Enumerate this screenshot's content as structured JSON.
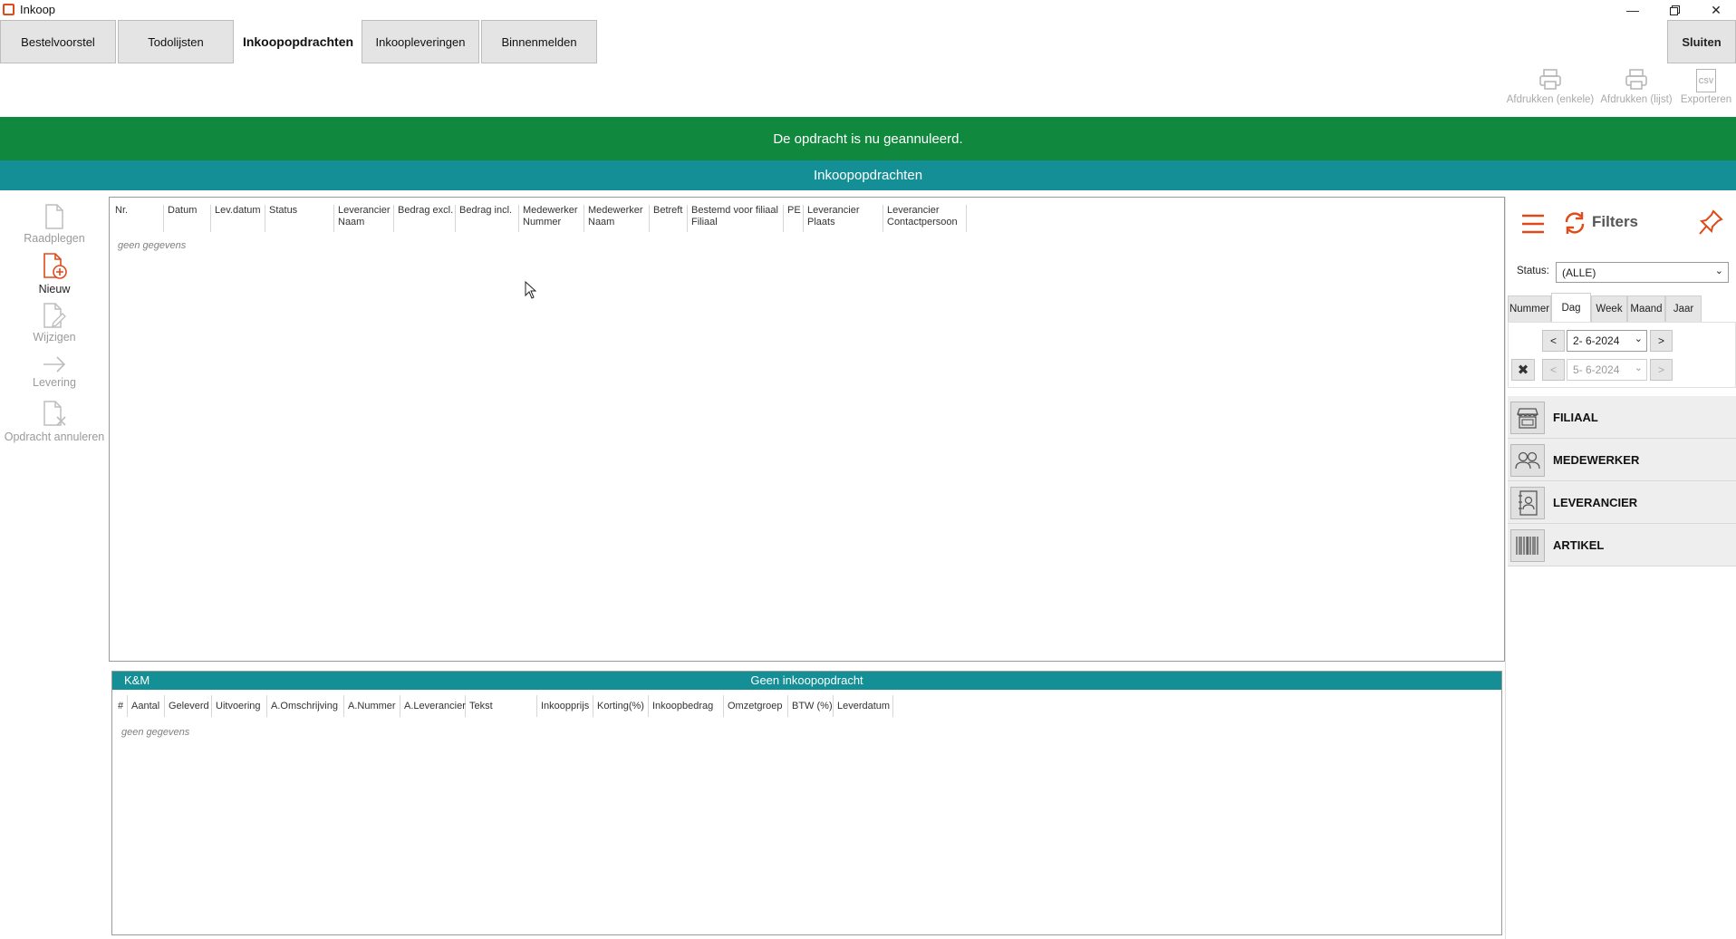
{
  "window": {
    "title": "Inkoop",
    "controls": [
      "minimize-icon",
      "restore-icon",
      "close-icon"
    ]
  },
  "tabs": [
    {
      "label": "Bestelvoorstel",
      "active": false
    },
    {
      "label": "Todolijsten",
      "active": false
    },
    {
      "label": "Inkoopopdrachten",
      "active": true
    },
    {
      "label": "Inkoopleveringen",
      "active": false
    },
    {
      "label": "Binnenmelden",
      "active": false
    }
  ],
  "close_button": "Sluiten",
  "toolbar": {
    "print_single": "Afdrukken (enkele)",
    "print_list": "Afdrukken (lijst)",
    "export": "Exporteren",
    "export_icon_text": "CSV"
  },
  "banners": {
    "success": "De opdracht is nu geannuleerd.",
    "section": "Inkoopopdrachten"
  },
  "sidebar": {
    "actions": [
      {
        "label": "Raadplegen",
        "icon": "document-icon",
        "enabled": false
      },
      {
        "label": "Nieuw",
        "icon": "new-document-icon",
        "enabled": true
      },
      {
        "label": "Wijzigen",
        "icon": "edit-document-icon",
        "enabled": false
      },
      {
        "label": "Levering",
        "icon": "arrow-right-icon",
        "enabled": false
      },
      {
        "label": "Opdracht annuleren",
        "icon": "cancel-document-icon",
        "enabled": false
      }
    ]
  },
  "main_grid": {
    "columns": [
      [
        "Nr.",
        ""
      ],
      [
        "Datum",
        ""
      ],
      [
        "Lev.datum",
        ""
      ],
      [
        "Status",
        ""
      ],
      [
        "Leverancier",
        "Naam"
      ],
      [
        "Bedrag excl.",
        ""
      ],
      [
        "Bedrag incl.",
        ""
      ],
      [
        "Medewerker",
        "Nummer"
      ],
      [
        "Medewerker",
        "Naam"
      ],
      [
        "Betreft",
        ""
      ],
      [
        "Bestemd voor filiaal",
        "Filiaal"
      ],
      [
        "PE",
        ""
      ],
      [
        "Leverancier",
        "Plaats"
      ],
      [
        "Leverancier",
        "Contactpersoon"
      ]
    ],
    "empty_text": "geen gegevens"
  },
  "bottom_grid": {
    "left_title": "K&M",
    "center_title": "Geen inkoopopdracht",
    "columns": [
      "#",
      "Aantal",
      "Geleverd",
      "Uitvoering",
      "A.Omschrijving",
      "A.Nummer",
      "A.Leverancier",
      "Tekst",
      "Inkoopprijs",
      "Korting(%)",
      "Inkoopbedrag",
      "Omzetgroep",
      "BTW (%)",
      "Leverdatum"
    ],
    "empty_text": "geen gegevens"
  },
  "filters": {
    "title": "Filters",
    "status_label": "Status:",
    "status_value": "(ALLE)",
    "period_tabs": [
      {
        "label": "Nummer",
        "active": false
      },
      {
        "label": "Dag",
        "active": true
      },
      {
        "label": "Week",
        "active": false
      },
      {
        "label": "Maand",
        "active": false
      },
      {
        "label": "Jaar",
        "active": false
      }
    ],
    "date_from": "2-  6-2024",
    "date_to": "5-  6-2024",
    "prev": "<",
    "next": ">",
    "facets": [
      "FILIAAL",
      "MEDEWERKER",
      "LEVERANCIER",
      "ARTIKEL"
    ]
  },
  "colors": {
    "accent": "#e04a1a",
    "success_banner": "#10893e",
    "teal": "#148f96"
  }
}
